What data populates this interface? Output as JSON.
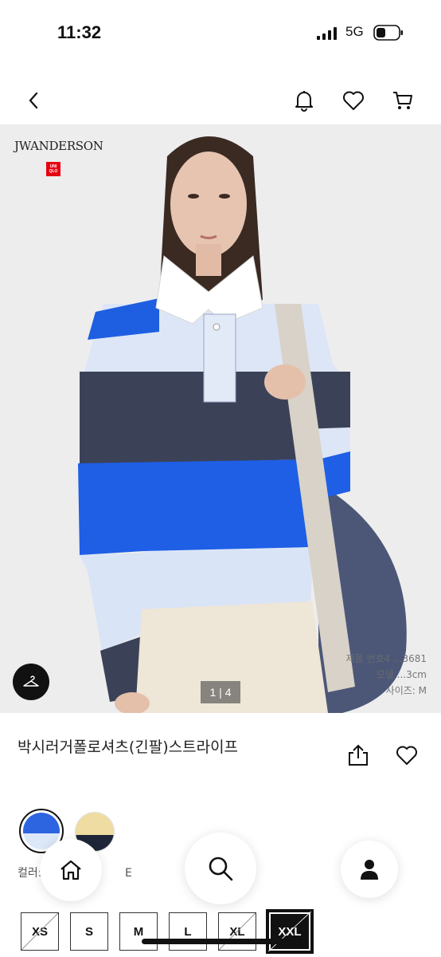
{
  "status_bar": {
    "time": "11:32",
    "network": "5G"
  },
  "nav": {
    "icons": [
      "back-icon",
      "bell-icon",
      "heart-icon",
      "cart-icon"
    ]
  },
  "hero": {
    "brand": "JWANDERSON",
    "uniqlo_logo": "UNI QLO",
    "page_indicator": "1 | 4",
    "model_info": [
      "제품 번호4 ...3681",
      "모델 ...3cm",
      "사이즈: M"
    ]
  },
  "product": {
    "title": "박시러거폴로셔츠(긴팔)스트라이프",
    "color_label": "컬러:",
    "color_value_partial": "E",
    "swatches": [
      {
        "name": "blue-white",
        "colors": [
          "#2d64e0",
          "#dce8f7"
        ]
      },
      {
        "name": "cream-navy",
        "colors": [
          "#efdca3",
          "#1e2638"
        ]
      }
    ],
    "sizes": [
      {
        "label": "XS",
        "available": false,
        "selected": false
      },
      {
        "label": "S",
        "available": true,
        "selected": false
      },
      {
        "label": "M",
        "available": true,
        "selected": false
      },
      {
        "label": "L",
        "available": true,
        "selected": false
      },
      {
        "label": "XL",
        "available": false,
        "selected": false
      },
      {
        "label": "XXL",
        "available": false,
        "selected": true
      }
    ]
  },
  "colors": {
    "accent": "#111111",
    "uniqlo_red": "#e60012"
  }
}
